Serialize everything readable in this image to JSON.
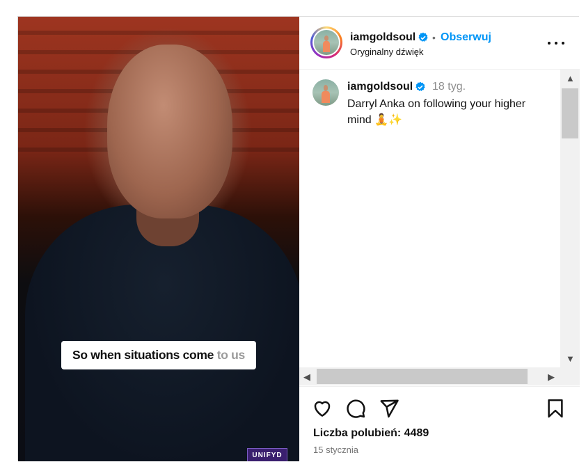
{
  "video": {
    "caption_main": "So when situations come",
    "caption_faded": "to us",
    "watermark": "UNIFYD"
  },
  "header": {
    "username": "iamgoldsoul",
    "separator": "•",
    "follow_label": "Obserwuj",
    "audio_label": "Oryginalny dźwięk",
    "verified_icon": "verified-badge-icon",
    "more_icon": "more-options-icon"
  },
  "post_caption": {
    "username": "iamgoldsoul",
    "time_ago": "18 tyg.",
    "text": "Darryl Anka on following your higher mind 🧘✨"
  },
  "actions": {
    "icons": [
      "heart-icon",
      "comment-icon",
      "share-icon",
      "bookmark-icon"
    ],
    "likes_label": "Liczba polubień: 4489",
    "date": "15 stycznia"
  },
  "scrollbars": {
    "up": "▲",
    "down": "▼",
    "left": "◀",
    "right": "▶"
  },
  "colors": {
    "accent": "#0095f6",
    "verified": "#0095f6",
    "text": "#111111",
    "muted": "#737373"
  }
}
